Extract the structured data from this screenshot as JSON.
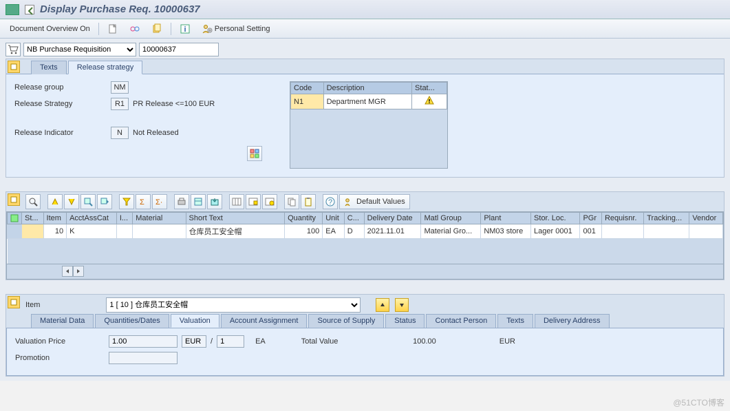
{
  "title": "Display Purchase Req. 10000637",
  "appbar": {
    "doc_overview": "Document Overview On",
    "personal_setting": "Personal Setting"
  },
  "doc": {
    "type_option": "NB Purchase Requisition",
    "number": "10000637"
  },
  "header_tabs": [
    "Texts",
    "Release strategy"
  ],
  "header_active_tab": 1,
  "release": {
    "group_label": "Release group",
    "group_value": "NM",
    "strategy_label": "Release Strategy",
    "strategy_value": "R1",
    "strategy_text": "PR Release <=100 EUR",
    "indicator_label": "Release Indicator",
    "indicator_value": "N",
    "indicator_text": "Not Released",
    "table": {
      "cols": [
        "Code",
        "Description",
        "Stat..."
      ],
      "row": {
        "code": "N1",
        "desc": "Department MGR"
      }
    }
  },
  "grid_toolbar": {
    "default_values": "Default Values"
  },
  "grid": {
    "cols": [
      "St...",
      "Item",
      "AcctAssCat",
      "I...",
      "Material",
      "Short Text",
      "Quantity",
      "Unit",
      "C...",
      "Delivery Date",
      "Matl Group",
      "Plant",
      "Stor. Loc.",
      "PGr",
      "Requisnr.",
      "Tracking...",
      "Vendor"
    ],
    "row": {
      "item": "10",
      "acct": "K",
      "i": "",
      "material": "",
      "short_text": "仓库员工安全帽",
      "qty": "100",
      "unit": "EA",
      "c": "D",
      "deliv": "2021.11.01",
      "matlgrp": "Material Gro...",
      "plant": "NM03 store",
      "sloc": "Lager 0001",
      "pgr": "001",
      "requisnr": "",
      "tracking": "",
      "vendor": ""
    }
  },
  "item": {
    "label": "Item",
    "selected": "1 [ 10 ] 仓库员工安全帽"
  },
  "detail_tabs": [
    "Material Data",
    "Quantities/Dates",
    "Valuation",
    "Account Assignment",
    "Source of Supply",
    "Status",
    "Contact Person",
    "Texts",
    "Delivery Address"
  ],
  "detail_active_tab": 2,
  "valuation": {
    "price_label": "Valuation Price",
    "price": "1.00",
    "curr": "EUR",
    "slash": "/",
    "per": "1",
    "unit": "EA",
    "total_label": "Total Value",
    "total": "100.00",
    "total_curr": "EUR",
    "promotion_label": "Promotion"
  },
  "watermark": "@51CTO博客"
}
